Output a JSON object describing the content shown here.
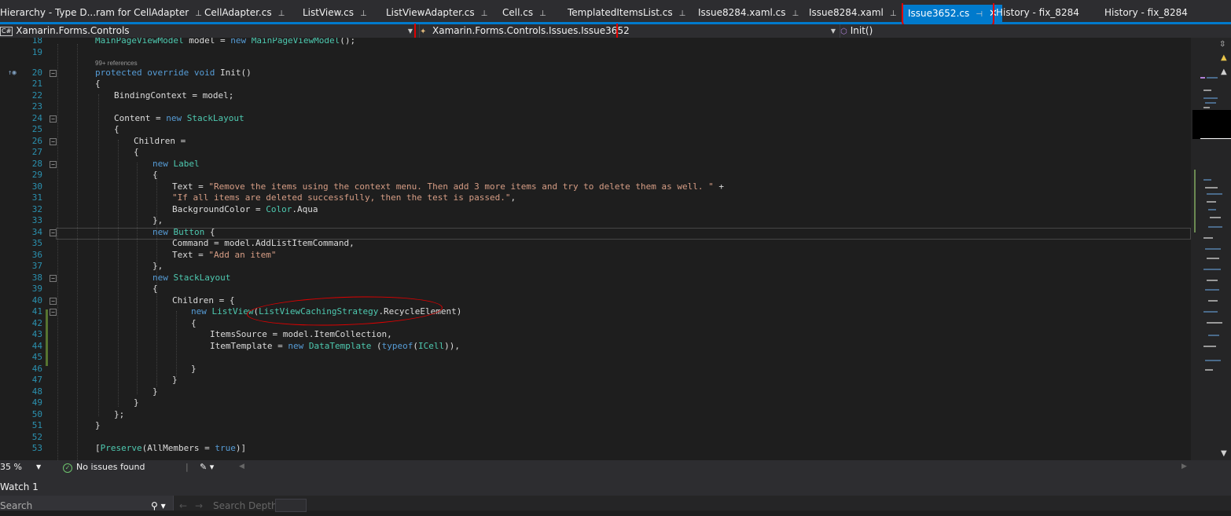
{
  "tabs": [
    {
      "label": "Hierarchy - Type D...ram for CellAdapter",
      "pinned": true
    },
    {
      "label": "CellAdapter.cs",
      "pinned": true
    },
    {
      "label": "ListView.cs",
      "pinned": true
    },
    {
      "label": "ListViewAdapter.cs",
      "pinned": true
    },
    {
      "label": "Cell.cs",
      "pinned": true
    },
    {
      "label": "TemplatedItemsList.cs",
      "pinned": true
    },
    {
      "label": "Issue8284.xaml.cs",
      "pinned": true
    },
    {
      "label": "Issue8284.xaml",
      "pinned": true
    },
    {
      "label": "Issue3652.cs",
      "active": true
    },
    {
      "label": "History - fix_8284"
    },
    {
      "label": "History - fix_8284"
    }
  ],
  "navbar": {
    "project": "Xamarin.Forms.Controls",
    "project_badge": "C#",
    "type": "Xamarin.Forms.Controls.Issues.Issue3652",
    "member": "Init()"
  },
  "code_lines": [
    {
      "n": "18",
      "text": "MainPageViewModel model = new MainPageViewModel();"
    },
    {
      "n": "19",
      "text": ""
    },
    {
      "n": "20",
      "text": "protected override void Init()",
      "refs": "99+ references"
    },
    {
      "n": "21",
      "text": "{"
    },
    {
      "n": "22",
      "text": "BindingContext = model;"
    },
    {
      "n": "23",
      "text": ""
    },
    {
      "n": "24",
      "text": "Content = new StackLayout"
    },
    {
      "n": "25",
      "text": "{"
    },
    {
      "n": "26",
      "text": "Children ="
    },
    {
      "n": "27",
      "text": "{"
    },
    {
      "n": "28",
      "text": "new Label"
    },
    {
      "n": "29",
      "text": "{"
    },
    {
      "n": "30",
      "text": "Text = \"Remove the items using the context menu. Then add 3 more items and try to delete them as well. \" +"
    },
    {
      "n": "31",
      "text": "\"If all items are deleted successfully, then the test is passed.\","
    },
    {
      "n": "32",
      "text": "BackgroundColor = Color.Aqua"
    },
    {
      "n": "33",
      "text": "},"
    },
    {
      "n": "34",
      "text": "new Button {"
    },
    {
      "n": "35",
      "text": "Command = model.AddListItemCommand,"
    },
    {
      "n": "36",
      "text": "Text = \"Add an item\""
    },
    {
      "n": "37",
      "text": "},"
    },
    {
      "n": "38",
      "text": "new StackLayout"
    },
    {
      "n": "39",
      "text": "{"
    },
    {
      "n": "40",
      "text": "Children = {"
    },
    {
      "n": "41",
      "text": "new ListView(ListViewCachingStrategy.RecycleElement)"
    },
    {
      "n": "42",
      "text": "{"
    },
    {
      "n": "43",
      "text": "ItemsSource = model.ItemCollection,"
    },
    {
      "n": "44",
      "text": "ItemTemplate = new DataTemplate (typeof(ICell)),"
    },
    {
      "n": "45",
      "text": ""
    },
    {
      "n": "46",
      "text": "}"
    },
    {
      "n": "47",
      "text": "}"
    },
    {
      "n": "48",
      "text": "}"
    },
    {
      "n": "49",
      "text": "}"
    },
    {
      "n": "50",
      "text": "};"
    },
    {
      "n": "51",
      "text": "}"
    },
    {
      "n": "52",
      "text": ""
    },
    {
      "n": "53",
      "text": "[Preserve(AllMembers = true)]"
    }
  ],
  "status": {
    "zoom": "35 %",
    "issues": "No issues found"
  },
  "watch": {
    "title": "Watch 1",
    "search_placeholder": "Search",
    "search_depth_label": "Search Depth:"
  },
  "colors": {
    "keyword": "#569cd6",
    "type": "#4ec9b0",
    "string": "#d69d85",
    "accent": "#007acc",
    "annotation": "#e00000"
  }
}
